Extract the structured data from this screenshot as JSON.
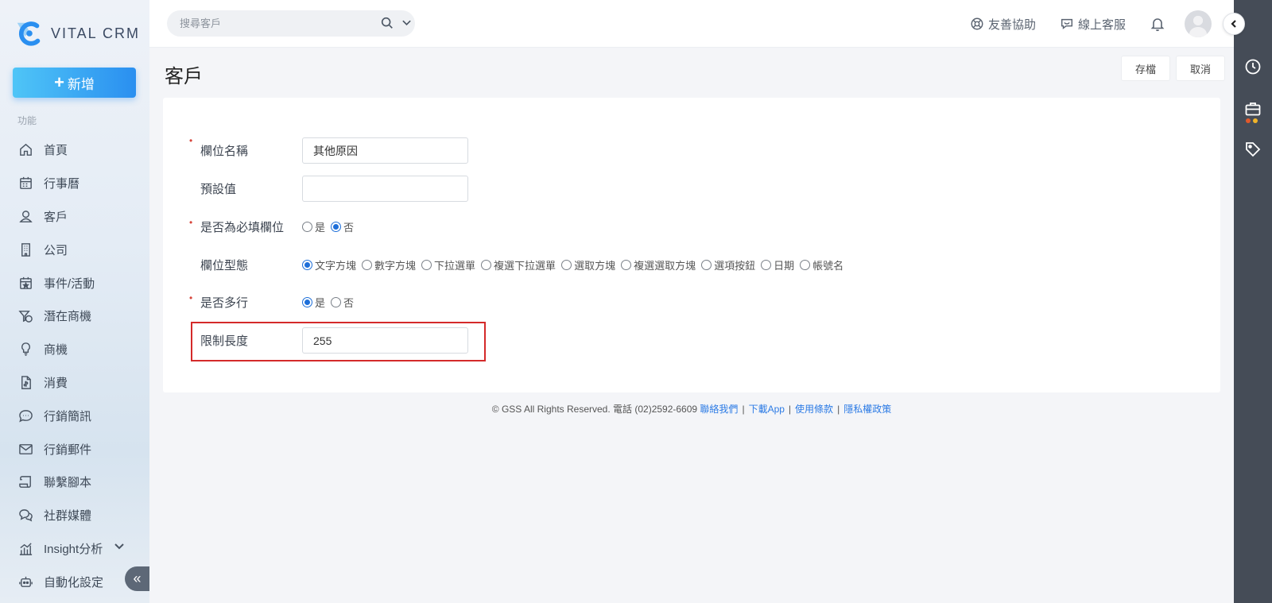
{
  "app": {
    "logo_text": "VITAL CRM",
    "new_button": "新增",
    "section_label": "功能"
  },
  "sidebar": {
    "items": [
      {
        "label": "首頁",
        "icon": "home-icon"
      },
      {
        "label": "行事曆",
        "icon": "calendar-icon"
      },
      {
        "label": "客戶",
        "icon": "contact-icon"
      },
      {
        "label": "公司",
        "icon": "building-icon"
      },
      {
        "label": "事件/活動",
        "icon": "event-icon"
      },
      {
        "label": "潛在商機",
        "icon": "funnel-icon"
      },
      {
        "label": "商機",
        "icon": "bulb-icon"
      },
      {
        "label": "消費",
        "icon": "receipt-icon"
      },
      {
        "label": "行銷簡訊",
        "icon": "sms-icon"
      },
      {
        "label": "行銷郵件",
        "icon": "mail-icon"
      },
      {
        "label": "聯繫腳本",
        "icon": "script-icon"
      },
      {
        "label": "社群媒體",
        "icon": "chat-icon"
      },
      {
        "label": "Insight分析",
        "icon": "chart-icon"
      },
      {
        "label": "自動化設定",
        "icon": "robot-icon"
      }
    ]
  },
  "topbar": {
    "search_placeholder": "搜尋客戶",
    "help_label": "友善協助",
    "support_label": "線上客服"
  },
  "page": {
    "title": "客戶",
    "save_label": "存檔",
    "cancel_label": "取消"
  },
  "form": {
    "field_name": {
      "label": "欄位名稱",
      "value": "其他原因"
    },
    "default_value": {
      "label": "預設值",
      "value": ""
    },
    "required": {
      "label": "是否為必填欄位",
      "options": [
        "是",
        "否"
      ],
      "selected": "否"
    },
    "field_type": {
      "label": "欄位型態",
      "options": [
        "文字方塊",
        "數字方塊",
        "下拉選單",
        "複選下拉選單",
        "選取方塊",
        "複選選取方塊",
        "選項按鈕",
        "日期",
        "帳號名"
      ],
      "selected": "文字方塊"
    },
    "multiline": {
      "label": "是否多行",
      "options": [
        "是",
        "否"
      ],
      "selected": "是"
    },
    "max_length": {
      "label": "限制長度",
      "value": "255"
    }
  },
  "footer": {
    "copyright": "© GSS All Rights Reserved. 電話 (02)2592-6609",
    "links": [
      "聯絡我們",
      "下載App",
      "使用條款",
      "隱私權政策"
    ]
  },
  "colors": {
    "accent": "#2a8ff0",
    "rail": "#454c57",
    "highlight": "#d42a2a"
  }
}
